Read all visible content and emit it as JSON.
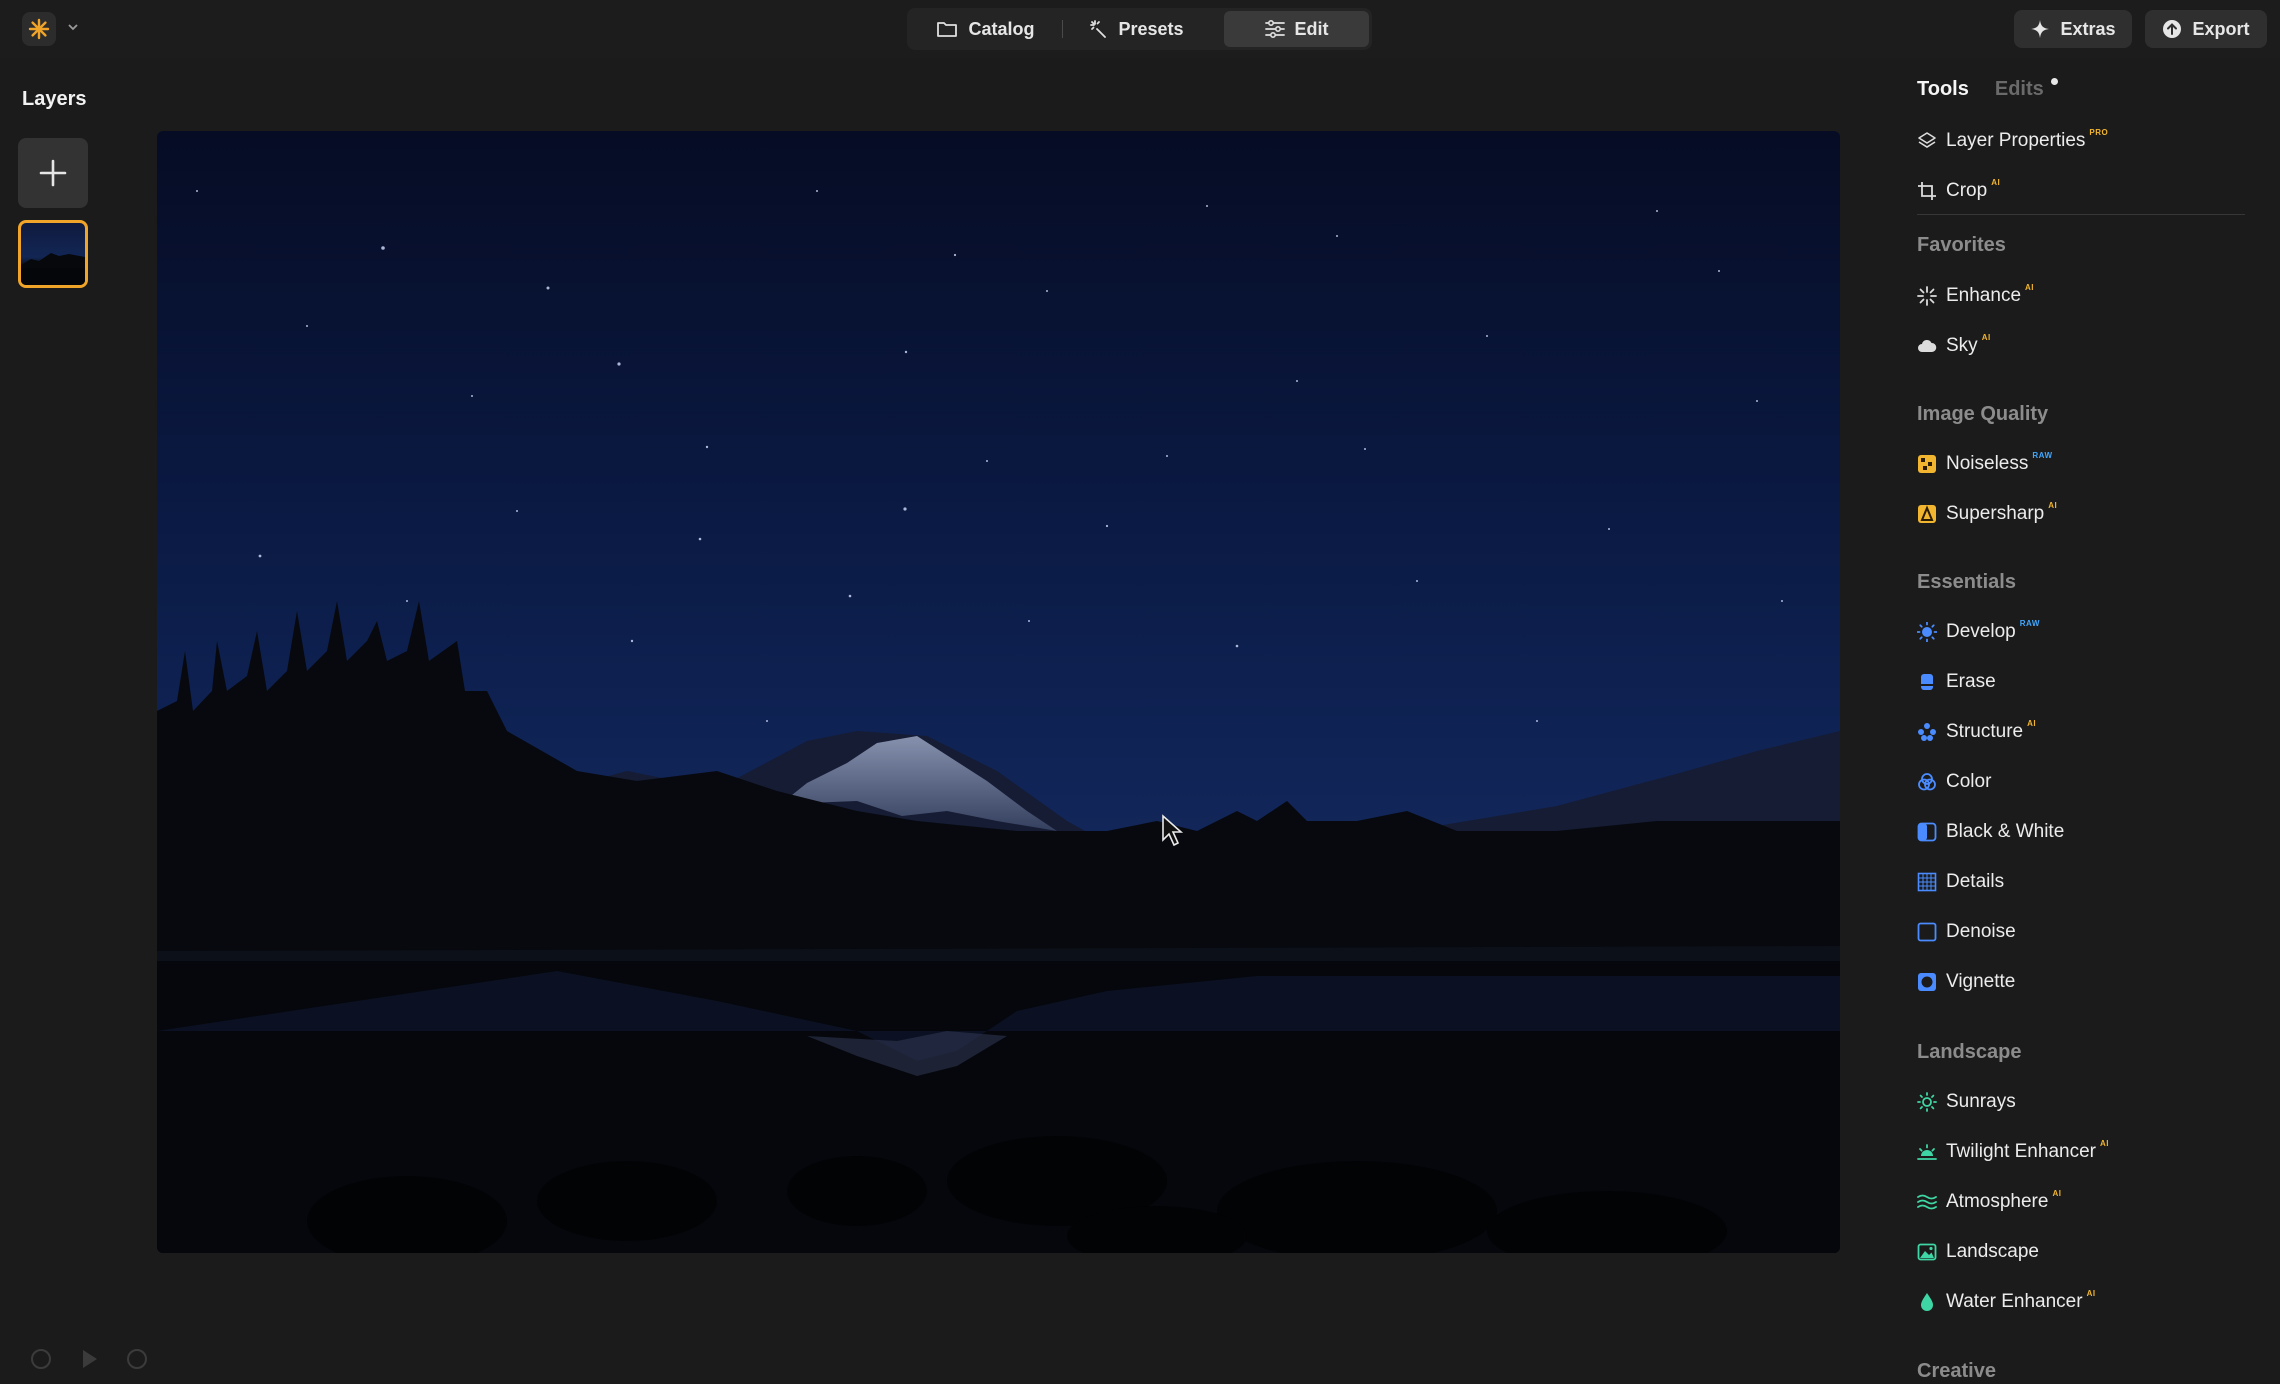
{
  "topbar": {
    "tabs": [
      {
        "label": "Catalog",
        "icon": "folder-icon"
      },
      {
        "label": "Presets",
        "icon": "magic-wand-icon"
      },
      {
        "label": "Edit",
        "icon": "sliders-icon"
      }
    ],
    "extras_label": "Extras",
    "export_label": "Export"
  },
  "layers": {
    "title": "Layers"
  },
  "panel": {
    "tabs": {
      "tools": "Tools",
      "edits": "Edits"
    },
    "top_items": [
      {
        "label": "Layer Properties",
        "badge": "PRO",
        "icon": "layers-icon"
      },
      {
        "label": "Crop",
        "badge": "AI",
        "icon": "crop-icon"
      }
    ],
    "sections": [
      {
        "title": "Favorites",
        "items": [
          {
            "label": "Enhance",
            "badge": "AI",
            "icon": "sparkle-icon"
          },
          {
            "label": "Sky",
            "badge": "AI",
            "icon": "cloud-icon"
          }
        ]
      },
      {
        "title": "Image Quality",
        "items": [
          {
            "label": "Noiseless",
            "badge": "RAW",
            "icon": "noiseless-icon"
          },
          {
            "label": "Supersharp",
            "badge": "AI",
            "icon": "supersharp-icon"
          }
        ]
      },
      {
        "title": "Essentials",
        "items": [
          {
            "label": "Develop",
            "badge": "RAW",
            "icon": "sun-icon"
          },
          {
            "label": "Erase",
            "badge": "",
            "icon": "eraser-icon"
          },
          {
            "label": "Structure",
            "badge": "AI",
            "icon": "structure-icon"
          },
          {
            "label": "Color",
            "badge": "",
            "icon": "color-icon"
          },
          {
            "label": "Black & White",
            "badge": "",
            "icon": "black-white-icon"
          },
          {
            "label": "Details",
            "badge": "",
            "icon": "details-icon"
          },
          {
            "label": "Denoise",
            "badge": "",
            "icon": "denoise-icon"
          },
          {
            "label": "Vignette",
            "badge": "",
            "icon": "vignette-icon"
          }
        ]
      },
      {
        "title": "Landscape",
        "items": [
          {
            "label": "Sunrays",
            "badge": "",
            "icon": "sunrays-icon"
          },
          {
            "label": "Twilight Enhancer",
            "badge": "AI",
            "icon": "twilight-icon"
          },
          {
            "label": "Atmosphere",
            "badge": "AI",
            "icon": "atmosphere-icon"
          },
          {
            "label": "Landscape",
            "badge": "",
            "icon": "landscape-icon"
          },
          {
            "label": "Water Enhancer",
            "badge": "AI",
            "icon": "water-drop-icon"
          }
        ]
      },
      {
        "title": "Creative",
        "items": []
      }
    ]
  },
  "colors": {
    "accent": "#f0a429",
    "ai_badge": "#f2b530",
    "raw_badge": "#41a7ff",
    "essentials_icon": "#4a8cff",
    "landscape_icon": "#3fd6a5"
  }
}
